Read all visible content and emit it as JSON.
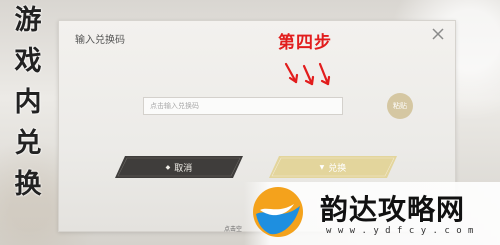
{
  "dialog": {
    "title": "输入兑换码",
    "input_placeholder": "点击输入兑换码",
    "paste_label": "粘贴",
    "cancel_label": "取消",
    "confirm_label": "兑换",
    "close_icon": "close-icon"
  },
  "footer": {
    "hint": "点击空"
  },
  "annotations": {
    "side_caption": [
      "游",
      "戏",
      "内",
      "兑",
      "换"
    ],
    "step_label": "第四步",
    "arrow_color": "#e21d1d"
  },
  "watermark": {
    "title": "韵达攻略网",
    "url": "w w w . y d f c y . c o m"
  },
  "colors": {
    "cancel_button": "#3f3d3b",
    "confirm_button": "#e3d59c",
    "paste_button": "#d5c7a2",
    "logo_orange": "#f4a21c",
    "logo_blue": "#1e8fe0"
  }
}
